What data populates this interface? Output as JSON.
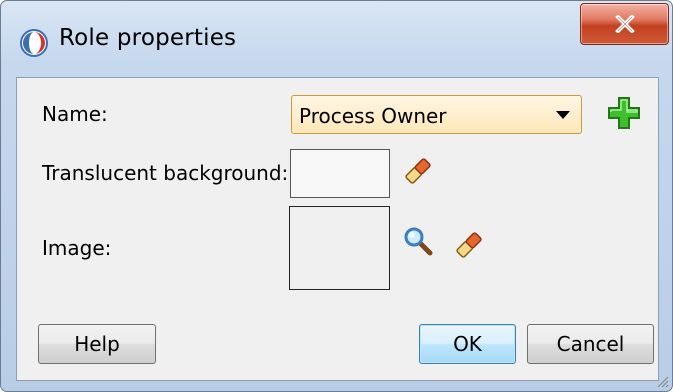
{
  "window": {
    "title": "Role properties",
    "close_label": "X"
  },
  "form": {
    "name_label": "Name:",
    "name_value": "Process Owner",
    "background_label": "Translucent background:",
    "image_label": "Image:"
  },
  "buttons": {
    "help": "Help",
    "ok": "OK",
    "cancel": "Cancel"
  },
  "icons": {
    "app": "app-logo-icon",
    "add": "plus-icon",
    "clear_background": "eraser-icon",
    "browse_image": "magnifier-icon",
    "clear_image": "eraser-icon",
    "resize": "resize-grip-icon"
  },
  "colors": {
    "add_icon": "#3fbe2e",
    "ok_border": "#3c7fb1",
    "close_button": "#c9452a"
  }
}
